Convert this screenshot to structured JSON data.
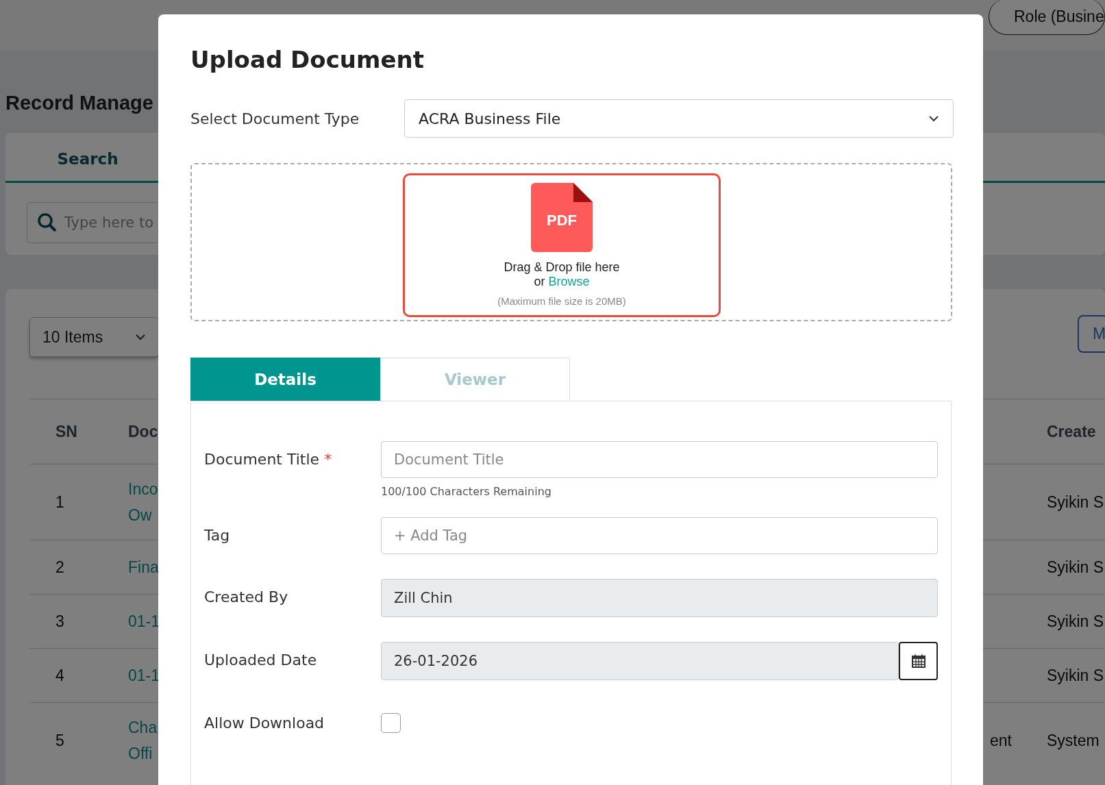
{
  "header": {
    "role_button": "Role (Busine"
  },
  "page": {
    "title": "Record Manage",
    "tabs": [
      {
        "label": "Search",
        "selected": true
      }
    ],
    "search": {
      "placeholder": "Type here to"
    },
    "page_size": "10 Items",
    "action_button": "M",
    "table": {
      "columns": [
        "SN",
        "Doc",
        "",
        "Create"
      ],
      "rows": [
        {
          "sn": "1",
          "document": [
            "Inco",
            "Ow"
          ],
          "created_by": "Syikin S"
        },
        {
          "sn": "2",
          "document": [
            "Fina"
          ],
          "created_by": "Syikin S"
        },
        {
          "sn": "3",
          "document": [
            "01-1"
          ],
          "created_by": "Syikin S"
        },
        {
          "sn": "4",
          "document": [
            "01-1"
          ],
          "created_by": "Syikin S"
        },
        {
          "sn": "5",
          "document": [
            "Cha",
            "Offi"
          ],
          "column_3": "ent",
          "created_by": "System"
        }
      ]
    }
  },
  "modal": {
    "title": "Upload Document",
    "document_type": {
      "label": "Select Document Type",
      "value": "ACRA Business File"
    },
    "dropzone": {
      "icon_label": "PDF",
      "line_1": "Drag & Drop file here",
      "line_2": "or",
      "link": "Browse",
      "note": "(Maximum file size is 20MB)"
    },
    "tabs": [
      {
        "label": "Details",
        "selected": true
      },
      {
        "label": "Viewer",
        "selected": false
      }
    ],
    "fields": [
      {
        "kind": "text",
        "label": "Document Title",
        "required_mark": "*",
        "placeholder": "Document Title",
        "helper": "100/100 Characters Remaining"
      },
      {
        "kind": "text",
        "label": "Tag",
        "placeholder": "+ Add Tag"
      },
      {
        "kind": "readonly",
        "label": "Created By",
        "value": "Zill Chin"
      },
      {
        "kind": "date",
        "label": "Uploaded Date",
        "value": "26-01-2026"
      },
      {
        "kind": "checkbox",
        "label": "Allow Download",
        "checked": false
      }
    ]
  }
}
